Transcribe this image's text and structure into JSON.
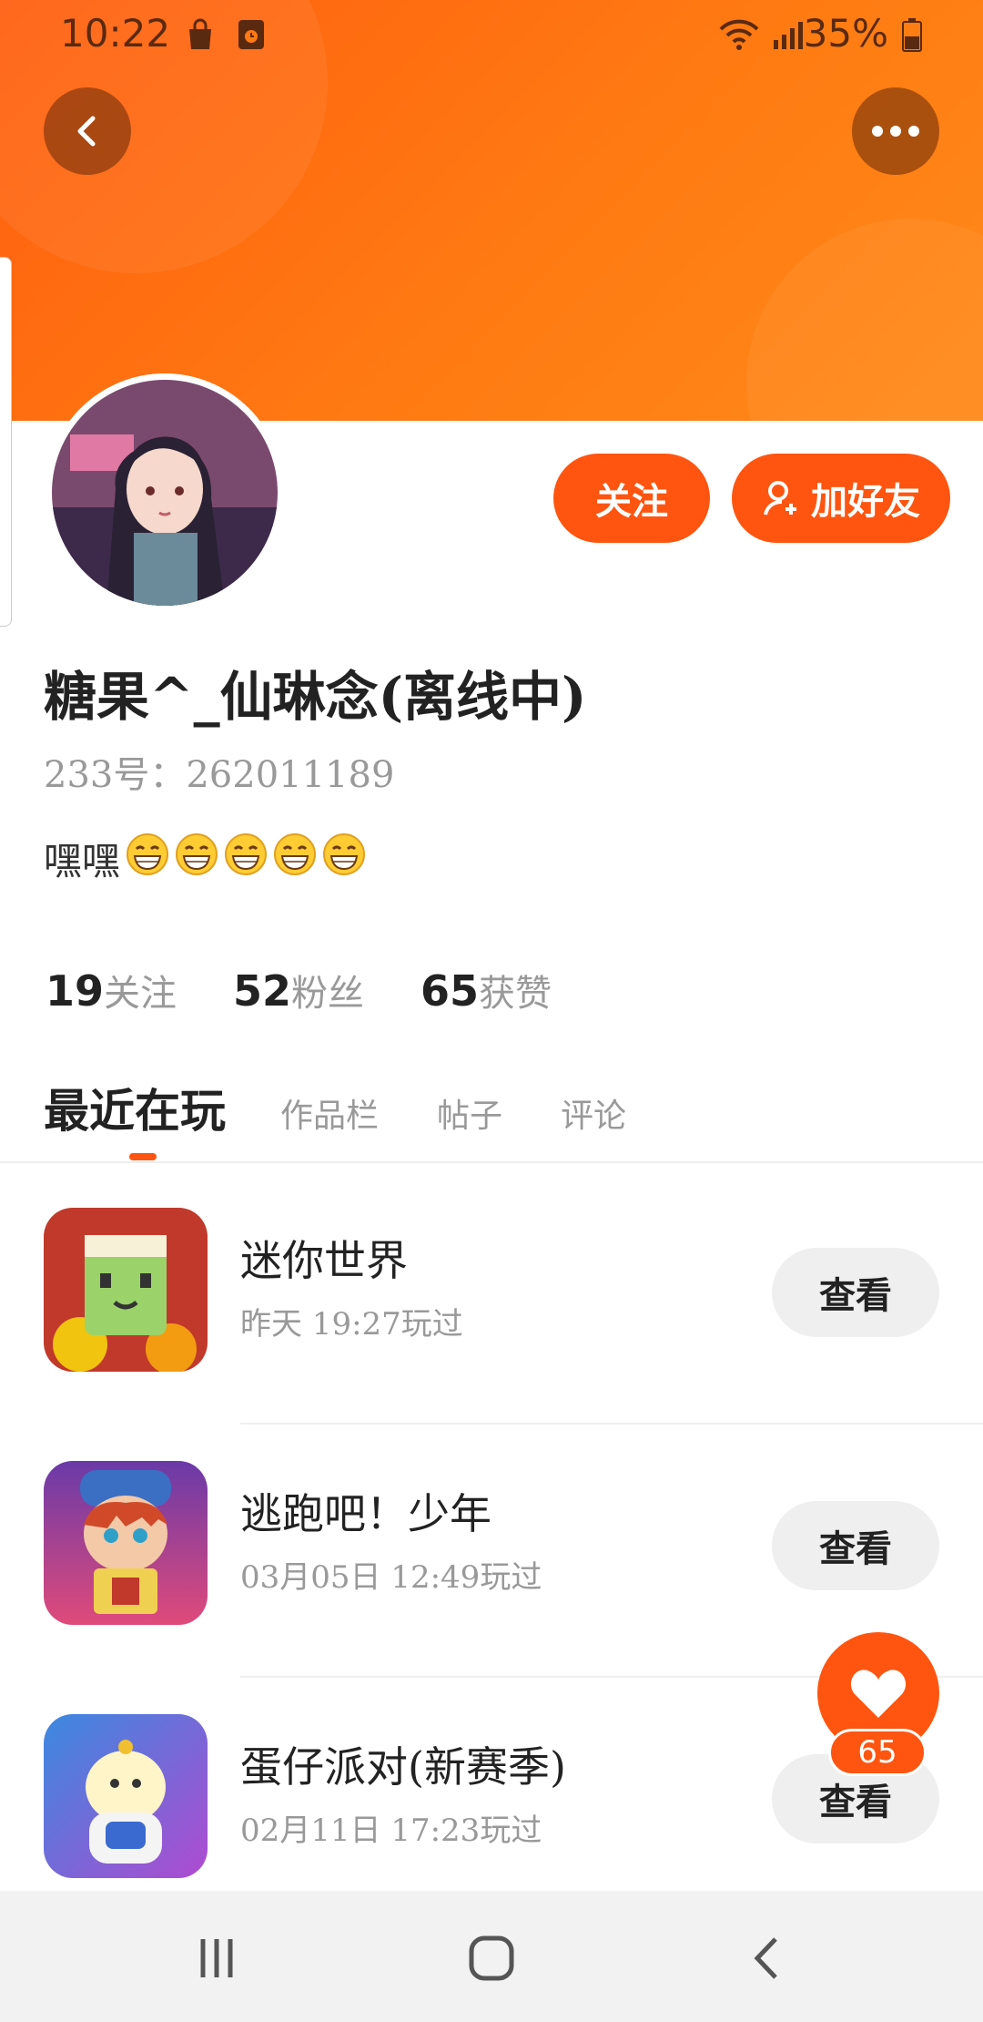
{
  "status_bar": {
    "time": "10:22",
    "battery": "35%",
    "icons": [
      "shopping-bag-icon",
      "app-notification-icon",
      "wifi-icon",
      "signal-icon",
      "battery-icon"
    ]
  },
  "header": {
    "back_icon": "chevron-left-icon",
    "more_icon": "more-dots-icon"
  },
  "profile": {
    "follow_label": "关注",
    "add_friend_label": "加好友",
    "add_friend_icon": "add-user-icon",
    "username": "糖果^_仙琳念(离线中)",
    "uid": "233号：262011189",
    "bio_text": "嘿嘿",
    "bio_emoji_count": 5,
    "stats": [
      {
        "num": "19",
        "label": "关注"
      },
      {
        "num": "52",
        "label": "粉丝"
      },
      {
        "num": "65",
        "label": "获赞"
      }
    ]
  },
  "tabs": [
    {
      "label": "最近在玩",
      "active": true
    },
    {
      "label": "作品栏",
      "active": false
    },
    {
      "label": "帖子",
      "active": false
    },
    {
      "label": "评论",
      "active": false
    }
  ],
  "games": [
    {
      "name": "迷你世界",
      "time": "昨天 19:27玩过",
      "button": "查看"
    },
    {
      "name": "逃跑吧！少年",
      "time": "03月05日 12:49玩过",
      "button": "查看"
    },
    {
      "name": "蛋仔派对(新赛季)",
      "time": "02月11日 17:23玩过",
      "button": "查看"
    }
  ],
  "like_fab": {
    "count": "65",
    "icon": "heart-icon"
  },
  "colors": {
    "accent": "#ff5510",
    "header_start": "#ff5f10",
    "header_end": "#ff8a1a"
  }
}
